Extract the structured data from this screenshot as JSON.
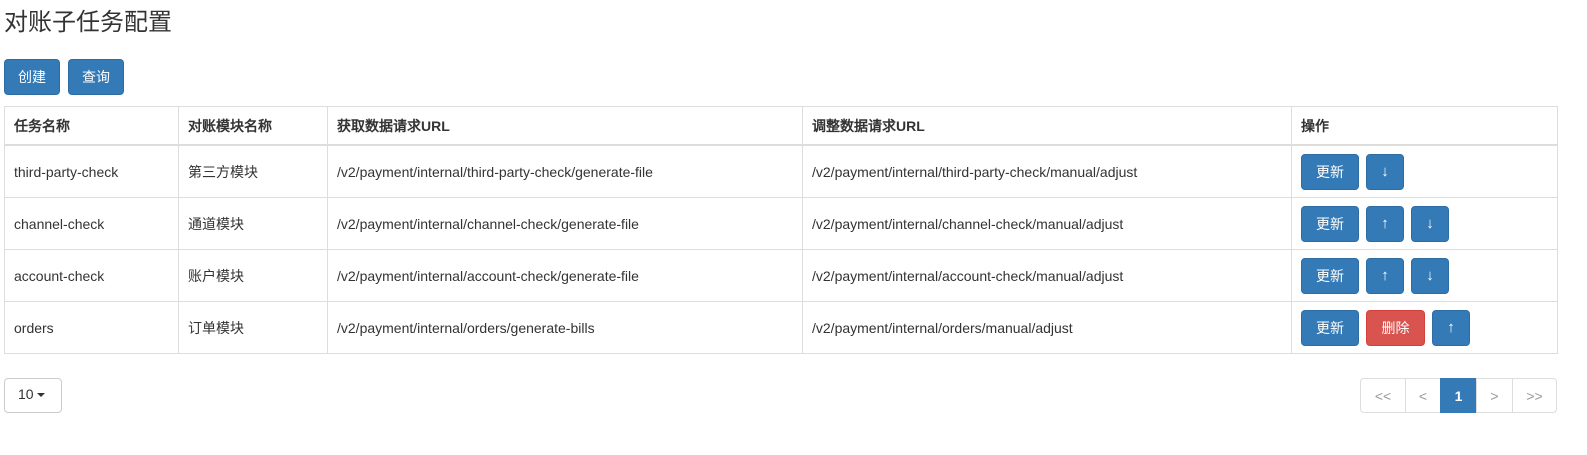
{
  "header": {
    "title": "对账子任务配置"
  },
  "toolbar": {
    "create_label": "创建",
    "query_label": "查询"
  },
  "table": {
    "columns": [
      "任务名称",
      "对账模块名称",
      "获取数据请求URL",
      "调整数据请求URL",
      "操作"
    ],
    "rows": [
      {
        "name": "third-party-check",
        "module": "第三方模块",
        "fetch_url": "/v2/payment/internal/third-party-check/generate-file",
        "adjust_url": "/v2/payment/internal/third-party-check/manual/adjust",
        "actions": [
          "更新",
          "↓"
        ]
      },
      {
        "name": "channel-check",
        "module": "通道模块",
        "fetch_url": "/v2/payment/internal/channel-check/generate-file",
        "adjust_url": "/v2/payment/internal/channel-check/manual/adjust",
        "actions": [
          "更新",
          "↑",
          "↓"
        ]
      },
      {
        "name": "account-check",
        "module": "账户模块",
        "fetch_url": "/v2/payment/internal/account-check/generate-file",
        "adjust_url": "/v2/payment/internal/account-check/manual/adjust",
        "actions": [
          "更新",
          "↑",
          "↓"
        ]
      },
      {
        "name": "orders",
        "module": "订单模块",
        "fetch_url": "/v2/payment/internal/orders/generate-bills",
        "adjust_url": "/v2/payment/internal/orders/manual/adjust",
        "actions": [
          "更新",
          "删除",
          "↑"
        ]
      }
    ]
  },
  "pagination": {
    "page_size": "10",
    "first": "<<",
    "prev": "<",
    "current": "1",
    "next": ">",
    "last": ">>"
  },
  "colors": {
    "primary": "#337ab7",
    "danger": "#d9534f",
    "border": "#dddddd"
  }
}
